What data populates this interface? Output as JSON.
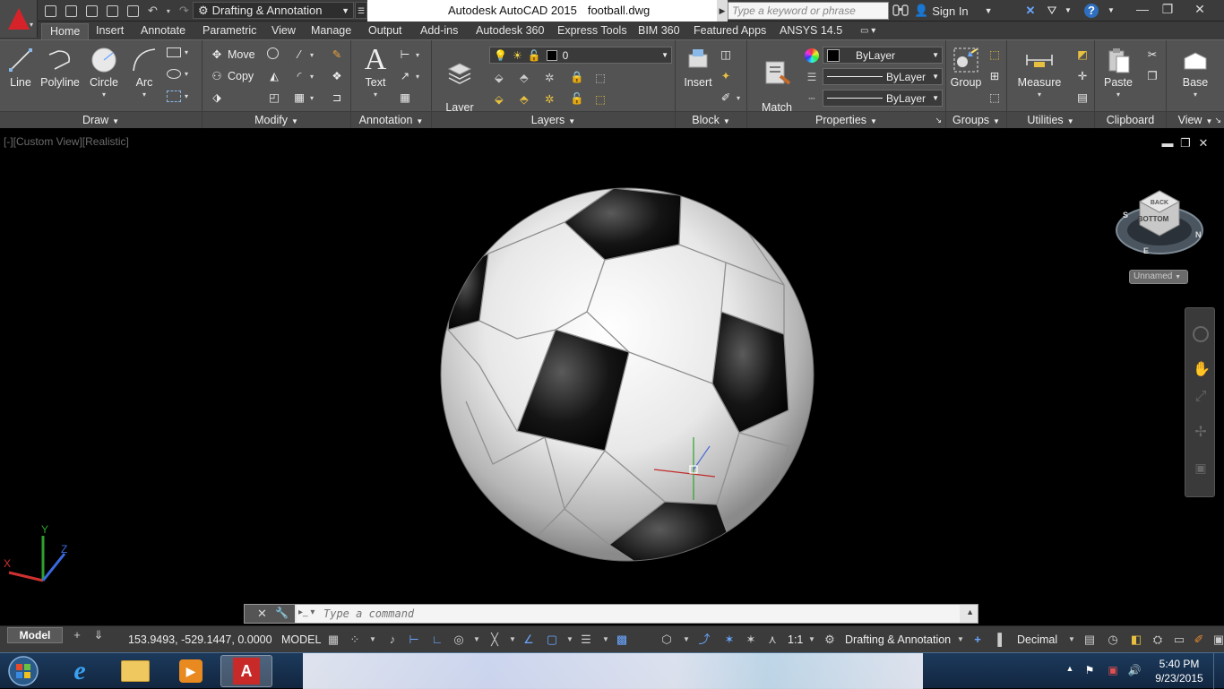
{
  "titlebar": {
    "workspace": "Drafting & Annotation",
    "app_title": "Autodesk AutoCAD 2015",
    "doc_name": "football.dwg",
    "search_placeholder": "Type a keyword or phrase",
    "signin": "Sign In"
  },
  "ribbon_tabs": [
    "Home",
    "Insert",
    "Annotate",
    "Parametric",
    "View",
    "Manage",
    "Output",
    "Add-ins",
    "Autodesk 360",
    "Express Tools",
    "BIM 360",
    "Featured Apps",
    "ANSYS 14.5"
  ],
  "draw": {
    "title": "Draw",
    "line": "Line",
    "polyline": "Polyline",
    "circle": "Circle",
    "arc": "Arc"
  },
  "modify": {
    "title": "Modify",
    "move": "Move",
    "copy": "Copy"
  },
  "annotation": {
    "title": "Annotation",
    "text": "Text"
  },
  "layers": {
    "title": "Layers",
    "layer_properties": "Layer\nProperties",
    "current_layer": "0"
  },
  "block": {
    "title": "Block",
    "insert": "Insert"
  },
  "properties": {
    "title": "Properties",
    "match": "Match\nProperties",
    "color": "ByLayer",
    "linetype": "ByLayer",
    "lineweight": "ByLayer"
  },
  "groups": {
    "title": "Groups",
    "group": "Group"
  },
  "utilities": {
    "title": "Utilities",
    "measure": "Measure"
  },
  "clipboard": {
    "title": "Clipboard",
    "paste": "Paste"
  },
  "view_panel": {
    "title": "View",
    "base": "Base"
  },
  "viewport": {
    "label": "[-][Custom View][Realistic]",
    "viewcube_face_top": "BACK",
    "viewcube_face_front": "BOTTOM",
    "compass": [
      "S",
      "E",
      "N"
    ],
    "ucs_name": "Unnamed"
  },
  "command": {
    "placeholder": "Type a command"
  },
  "statusbar": {
    "model_tab": "Model",
    "coords": "153.9493, -529.1447, 0.0000",
    "space": "MODEL",
    "scale": "1:1",
    "workspace": "Drafting & Annotation",
    "units": "Decimal"
  },
  "taskbar": {
    "time": "5:40 PM",
    "date": "9/23/2015"
  }
}
